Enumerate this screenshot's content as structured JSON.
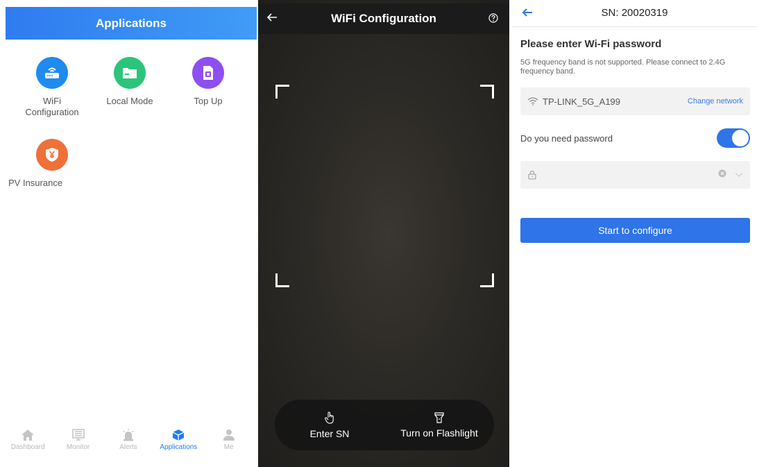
{
  "applications_screen": {
    "title": "Applications",
    "apps": [
      {
        "label_line1": "WiFi",
        "label_line2": "Configuration",
        "icon": "router-icon",
        "color": "#1e8bf0"
      },
      {
        "label_line1": "Local Mode",
        "label_line2": "",
        "icon": "folder-icon",
        "color": "#2cc47a"
      },
      {
        "label_line1": "Top Up",
        "label_line2": "",
        "icon": "sim-card-icon",
        "color": "#8e4ff0"
      },
      {
        "label_line1": "PV Insurance",
        "label_line2": "",
        "icon": "shield-yen-icon",
        "color": "#f0703a"
      }
    ],
    "tabbar": [
      {
        "label": "Dashboard",
        "icon": "home-icon",
        "active": false
      },
      {
        "label": "Monitor",
        "icon": "monitor-icon",
        "active": false
      },
      {
        "label": "Alerts",
        "icon": "alarm-icon",
        "active": false
      },
      {
        "label": "Applications",
        "icon": "cube-icon",
        "active": true
      },
      {
        "label": "Me",
        "icon": "user-icon",
        "active": false
      }
    ],
    "colors": {
      "header": "#2f7bf0",
      "active_tab": "#1f7cf2",
      "inactive_tab": "#b8b8b8"
    }
  },
  "scan_screen": {
    "title": "WiFi Configuration",
    "actions": [
      {
        "label": "Enter SN",
        "icon": "hand-pointer-icon"
      },
      {
        "label": "Turn on Flashlight",
        "icon": "flashlight-icon"
      }
    ]
  },
  "password_screen": {
    "title": "SN: 20020319",
    "heading": "Please enter Wi-Fi password",
    "note": "5G frequency band is not supported. Please connect to 2.4G frequency band.",
    "network_name": "TP-LINK_5G_A199",
    "change_network": "Change network",
    "need_password_label": "Do you need password",
    "need_password_on": true,
    "password_value": "",
    "start_button": "Start to configure",
    "colors": {
      "accent": "#2f74e8",
      "link": "#3b7de8"
    }
  }
}
